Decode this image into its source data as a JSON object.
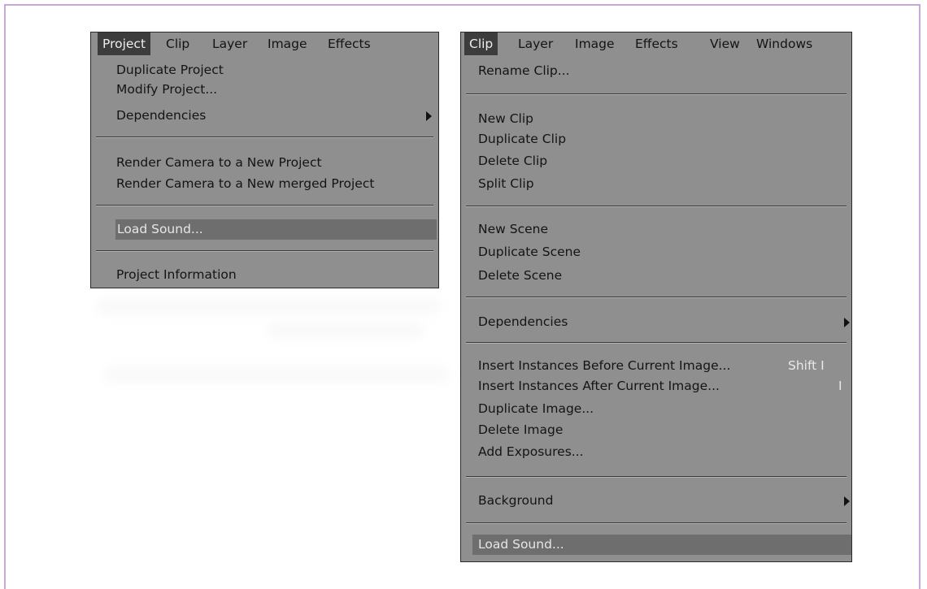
{
  "left_menu": {
    "menubar": [
      "Project",
      "Clip",
      "Layer",
      "Image",
      "Effects"
    ],
    "active": "Project",
    "items": {
      "duplicate_project": "Duplicate Project",
      "modify_project": "Modify Project...",
      "dependencies": "Dependencies",
      "render_new": "Render Camera to a New Project",
      "render_merged": "Render Camera to a New merged Project",
      "load_sound": "Load Sound...",
      "project_info": "Project Information"
    }
  },
  "right_menu": {
    "menubar": [
      "Clip",
      "Layer",
      "Image",
      "Effects",
      "View",
      "Windows"
    ],
    "active": "Clip",
    "items": {
      "rename_clip": "Rename Clip...",
      "new_clip": "New Clip",
      "duplicate_clip": "Duplicate Clip",
      "delete_clip": "Delete Clip",
      "split_clip": "Split Clip",
      "new_scene": "New Scene",
      "duplicate_scene": "Duplicate Scene",
      "delete_scene": "Delete Scene",
      "dependencies": "Dependencies",
      "insert_before": "Insert Instances Before Current Image...",
      "insert_before_shortcut": "Shift I",
      "insert_after": "Insert Instances After Current Image...",
      "insert_after_shortcut": "I",
      "duplicate_image": "Duplicate Image...",
      "delete_image": "Delete Image",
      "add_exposures": "Add Exposures...",
      "background": "Background",
      "load_sound": "Load Sound..."
    }
  },
  "colors": {
    "menu_bg": "#8f8f8f",
    "active_tab": "#3c3c3c",
    "highlight": "#6e6e6e",
    "frame_border": "#c8a8d8"
  }
}
